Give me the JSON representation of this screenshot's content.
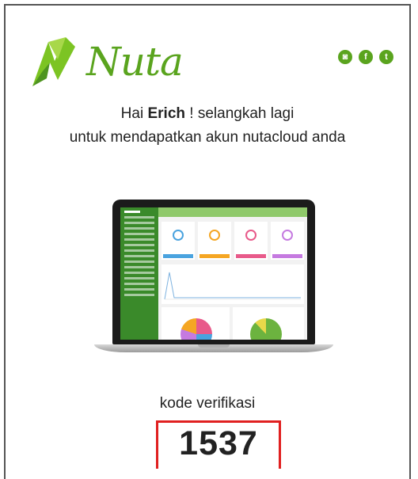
{
  "brand": {
    "name": "Nuta",
    "accent": "#5aa41e"
  },
  "social": [
    {
      "icon": "instagram-icon",
      "glyph": "◙"
    },
    {
      "icon": "facebook-icon",
      "glyph": "f"
    },
    {
      "icon": "twitter-icon",
      "glyph": "t"
    }
  ],
  "greeting": {
    "prefix": "Hai ",
    "name": "Erich",
    "suffix": " ! selangkah lagi",
    "line2": "untuk mendapatkan akun nutacloud anda"
  },
  "verification": {
    "label": "kode verifikasi",
    "code": "1537",
    "highlight": "#e02020"
  }
}
